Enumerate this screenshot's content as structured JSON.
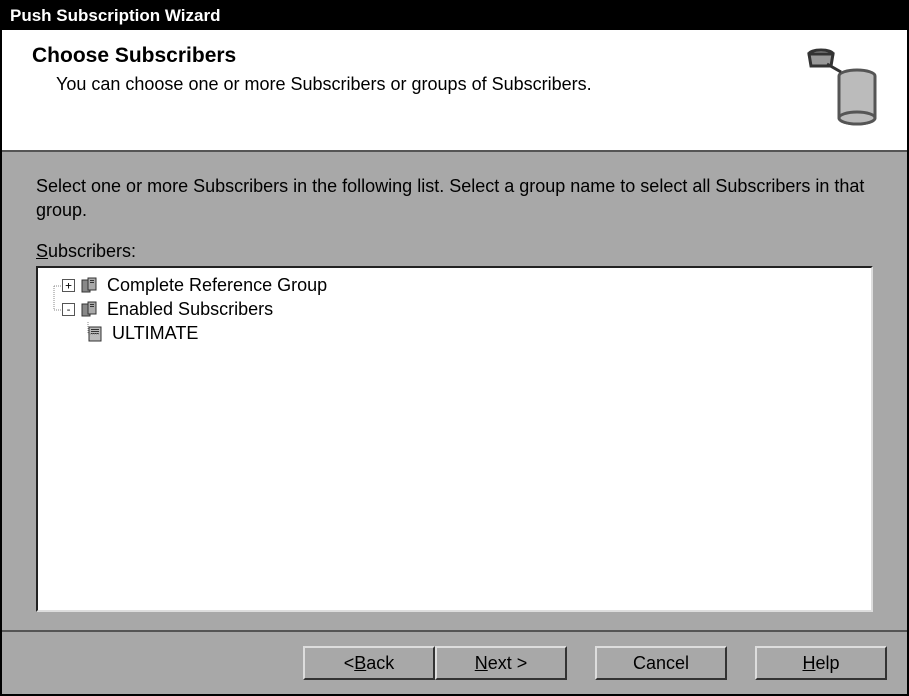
{
  "window": {
    "title": "Push Subscription Wizard"
  },
  "header": {
    "title": "Choose Subscribers",
    "subtitle": "You can choose one or more Subscribers or groups of Subscribers.",
    "icon": "database-trash-icon"
  },
  "body": {
    "instruction": "Select one or more Subscribers in the following list. Select a group name to select all Subscribers in that group.",
    "list_label_before": "S",
    "list_label_after": "ubscribers:"
  },
  "tree": {
    "nodes": [
      {
        "label": "Complete Reference Group",
        "icon": "server-group-icon",
        "expander": "+"
      },
      {
        "label": "Enabled Subscribers",
        "icon": "server-group-icon",
        "expander": "-"
      },
      {
        "label": "ULTIMATE",
        "icon": "server-icon",
        "expander": ""
      }
    ]
  },
  "buttons": {
    "back_prefix": "< ",
    "back_u": "B",
    "back_rest": "ack",
    "next_u": "N",
    "next_rest": "ext >",
    "cancel": "Cancel",
    "help_u": "H",
    "help_rest": "elp"
  }
}
